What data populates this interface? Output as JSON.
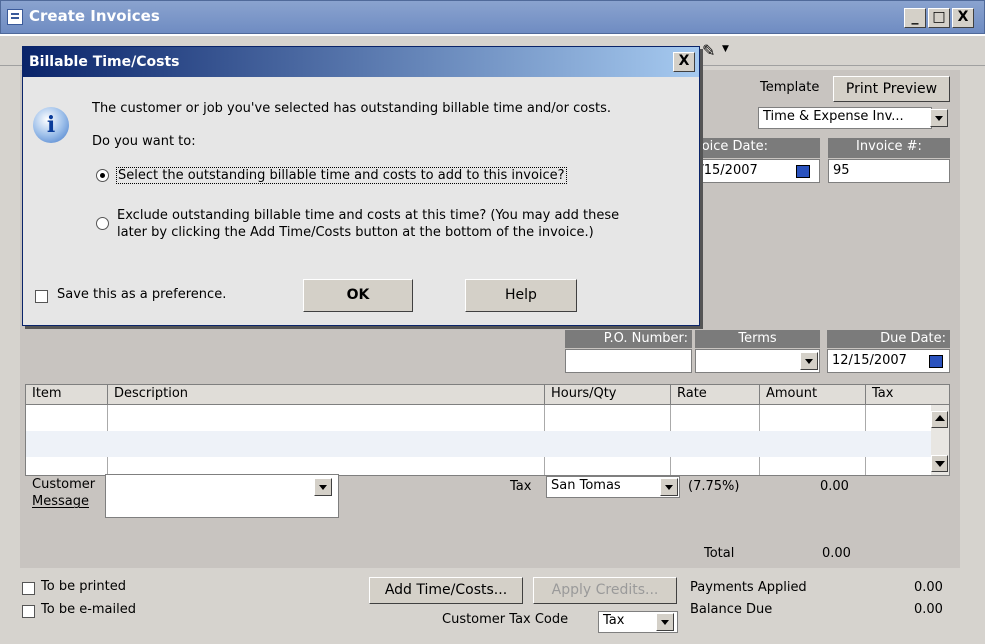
{
  "window": {
    "title": "Create Invoices",
    "min_label": "_",
    "max_label": "□",
    "close_label": "X"
  },
  "toolbar": {
    "dropdown_glyph": "▼"
  },
  "invoice": {
    "template_label": "Template",
    "print_preview_label": "Print Preview",
    "template_value": "Time & Expense Inv...",
    "invoice_date_label": "voice Date:",
    "invoice_date_value": ":/15/2007",
    "invoice_num_label": "Invoice #:",
    "invoice_num_value": "95",
    "po_number_label": "P.O. Number:",
    "terms_label": "Terms",
    "due_date_label": "Due Date:",
    "due_date_value": "12/15/2007",
    "columns": [
      "Item",
      "Description",
      "Hours/Qty",
      "Rate",
      "Amount",
      "Tax"
    ],
    "customer_message_label_1": "Customer",
    "customer_message_label_2": "Message",
    "tax_label": "Tax",
    "tax_value": "San Tomas",
    "tax_rate": "(7.75%)",
    "tax_amount": "0.00",
    "total_label": "Total",
    "total_value": "0.00"
  },
  "footer": {
    "to_be_printed": "To be printed",
    "to_be_emailed": "To be e-mailed",
    "add_time_costs": "Add Time/Costs...",
    "apply_credits": "Apply Credits...",
    "customer_tax_code_label": "Customer Tax Code",
    "customer_tax_code_value": "Tax",
    "payments_applied_label": "Payments Applied",
    "payments_applied_value": "0.00",
    "balance_due_label": "Balance Due",
    "balance_due_value": "0.00"
  },
  "dialog": {
    "title": "Billable Time/Costs",
    "close_label": "X",
    "icon_glyph": "i",
    "message": "The customer or job you've selected has outstanding billable time and/or costs.",
    "question": "Do you want to:",
    "option1": "Select the outstanding billable time and costs to add to this invoice?",
    "option2_line1": "Exclude outstanding billable time and costs at this time? (You may add these",
    "option2_line2": "later by clicking the Add Time/Costs button at the bottom of the invoice.)",
    "save_preference": "Save this as a preference.",
    "ok_label": "OK",
    "help_label": "Help"
  },
  "colors": {
    "title_bar": "#6f8cc2",
    "dialog_title": "#0a246a",
    "panel": "#c8c4c0"
  }
}
